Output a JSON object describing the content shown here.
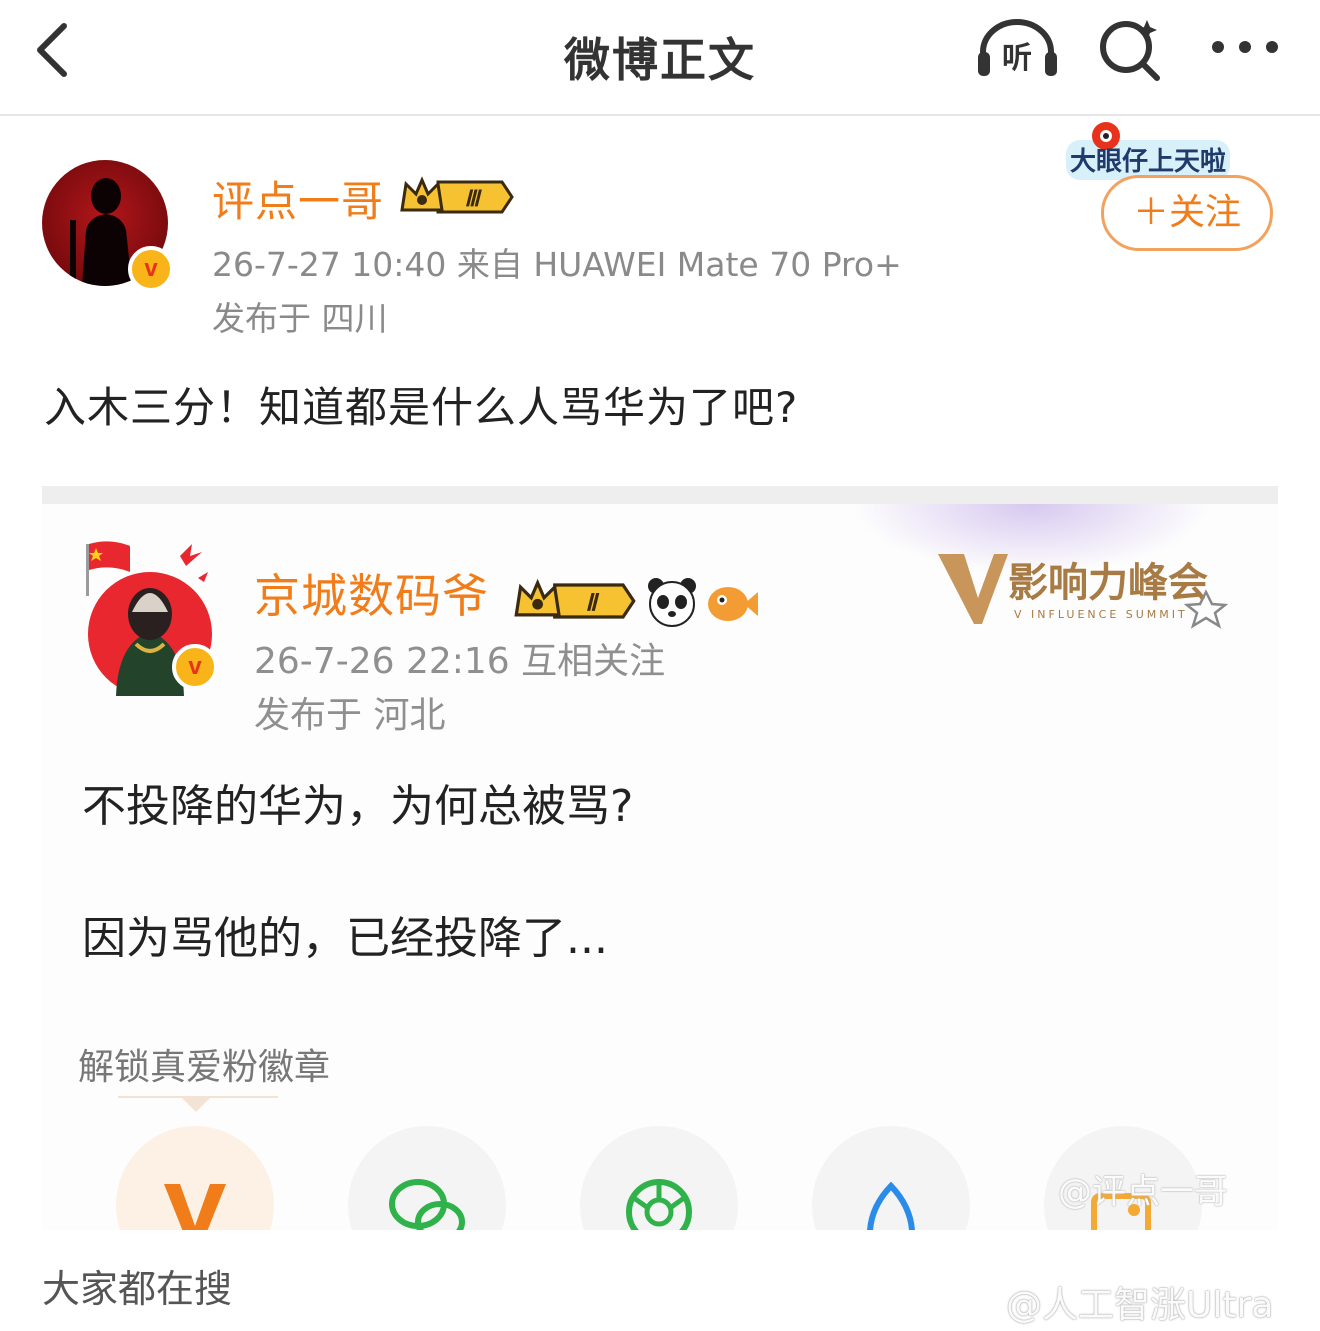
{
  "nav": {
    "title": "微博正文",
    "listen_label": "听"
  },
  "post": {
    "author": "评点一哥",
    "level_badge": "Ⅲ",
    "meta": "26-7-27 10:40  来自 HUAWEI Mate 70 Pro+",
    "location": "发布于 四川",
    "promo_sticker": "大眼仔上天啦",
    "follow_label": "＋关注",
    "text": "入木三分！知道都是什么人骂华为了吧?"
  },
  "embed": {
    "author": "京城数码爷",
    "level_badge": "Ⅱ",
    "summit_logo": "影响力峰会",
    "summit_sub": "V INFLUENCE SUMMIT",
    "meta": "26-7-26 22:16   互相关注",
    "location": "发布于 河北",
    "line1": "不投降的华为，为何总被骂?",
    "line2": "因为骂他的，已经投降了...",
    "unlock_label": "解锁真爱粉徽章",
    "share_icons": [
      "v-icon",
      "wechat-icon",
      "moments-icon",
      "qq-icon",
      "photo-icon"
    ],
    "watermark": "@评点一哥"
  },
  "footer": {
    "trending_label": "大家都在搜",
    "watermark": "@人工智涨Ultra"
  },
  "colors": {
    "accent": "#f07c1a",
    "gray_text": "#8a8a8a",
    "badge_gold": "#f8b418"
  }
}
